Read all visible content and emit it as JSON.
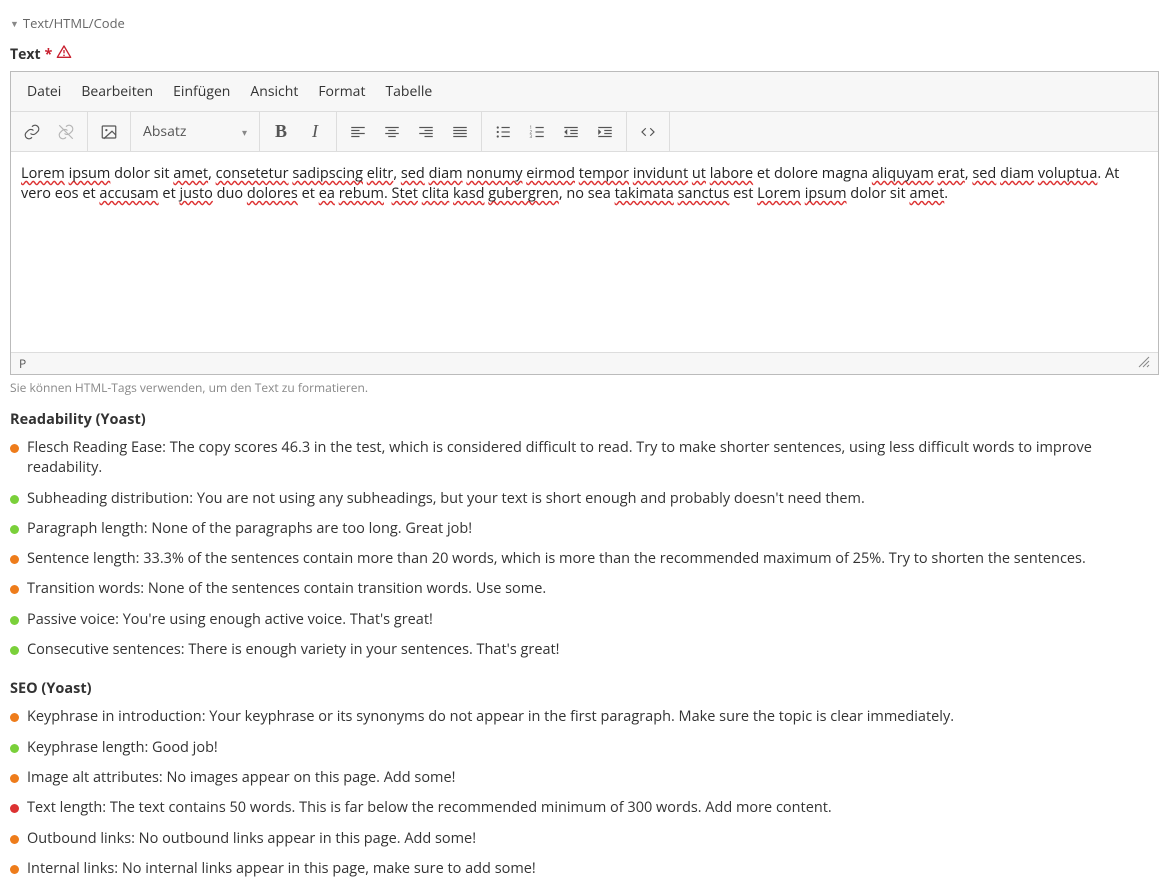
{
  "section": {
    "title": "Text/HTML/Code"
  },
  "field": {
    "label": "Text",
    "required": "*"
  },
  "menubar": {
    "file": "Datei",
    "edit": "Bearbeiten",
    "insert": "Einfügen",
    "view": "Ansicht",
    "format": "Format",
    "table": "Tabelle"
  },
  "toolbar": {
    "format_select": "Absatz",
    "bold_glyph": "B",
    "italic_glyph": "I"
  },
  "content": {
    "text": "Lorem ipsum dolor sit amet, consetetur sadipscing elitr, sed diam nonumy eirmod tempor invidunt ut labore et dolore magna aliquyam erat, sed diam voluptua. At vero eos et accusam et justo duo dolores et ea rebum. Stet clita kasd gubergren, no sea takimata sanctus est Lorem ipsum dolor sit amet."
  },
  "statusbar": {
    "path": "P"
  },
  "hint": "Sie können HTML-Tags verwenden, um den Text zu formatieren.",
  "readability": {
    "title": "Readability (Yoast)",
    "items": [
      {
        "score": "orange",
        "text": "Flesch Reading Ease: The copy scores 46.3 in the test, which is considered difficult to read. Try to make shorter sentences, using less difficult words to improve readability."
      },
      {
        "score": "green",
        "text": "Subheading distribution: You are not using any subheadings, but your text is short enough and probably doesn't need them."
      },
      {
        "score": "green",
        "text": "Paragraph length: None of the paragraphs are too long. Great job!"
      },
      {
        "score": "orange",
        "text": "Sentence length: 33.3% of the sentences contain more than 20 words, which is more than the recommended maximum of 25%. Try to shorten the sentences."
      },
      {
        "score": "orange",
        "text": "Transition words: None of the sentences contain transition words. Use some."
      },
      {
        "score": "green",
        "text": "Passive voice: You're using enough active voice. That's great!"
      },
      {
        "score": "green",
        "text": "Consecutive sentences: There is enough variety in your sentences. That's great!"
      }
    ]
  },
  "seo": {
    "title": "SEO (Yoast)",
    "items": [
      {
        "score": "orange",
        "text": "Keyphrase in introduction: Your keyphrase or its synonyms do not appear in the first paragraph. Make sure the topic is clear immediately."
      },
      {
        "score": "green",
        "text": "Keyphrase length: Good job!"
      },
      {
        "score": "orange",
        "text": "Image alt attributes: No images appear on this page. Add some!"
      },
      {
        "score": "red",
        "text": "Text length: The text contains 50 words. This is far below the recommended minimum of 300 words. Add more content."
      },
      {
        "score": "orange",
        "text": "Outbound links: No outbound links appear in this page. Add some!"
      },
      {
        "score": "orange",
        "text": "Internal links: No internal links appear in this page, make sure to add some!"
      }
    ]
  }
}
